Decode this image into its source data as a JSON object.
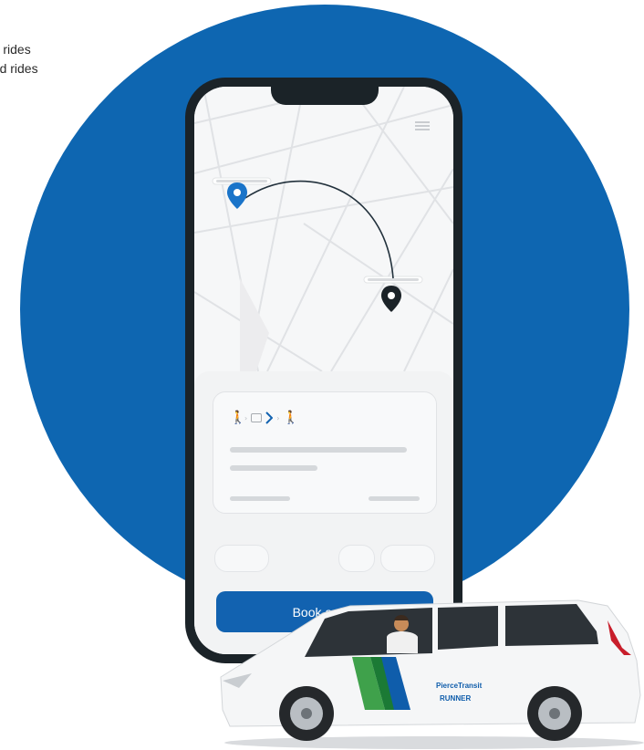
{
  "caption": {
    "line1": "ted rides",
    "line2": "leted rides"
  },
  "colors": {
    "circle": "#0e66b1",
    "button": "#1262b0",
    "phone_frame": "#1b2328",
    "van_body": "#f5f6f7",
    "stripe_green": "#3fa14b",
    "stripe_blue": "#0f5dab"
  },
  "app": {
    "menu_icon": "hamburger-icon",
    "origin_icon": "location-pin-blue",
    "destination_icon": "location-pin-black",
    "walk_icon": "walk-icon",
    "van_icon": "microtransit-icon",
    "book_button_label": "Book a ride"
  },
  "vehicle": {
    "brand_line1": "PierceTransit",
    "brand_line2": "RUNNER"
  }
}
